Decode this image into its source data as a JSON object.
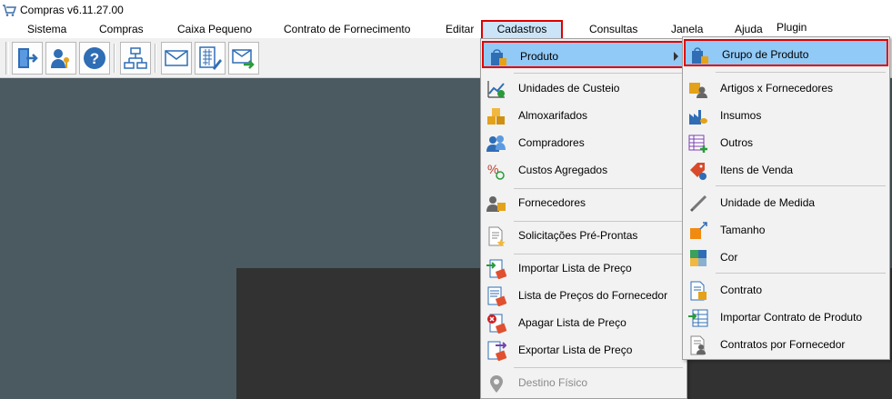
{
  "window": {
    "title": "Compras v6.11.27.00",
    "app_icon": "cart-icon"
  },
  "menubar": {
    "items": [
      "Sistema",
      "Compras",
      "Caixa Pequeno",
      "Contrato de Fornecimento",
      "Editar",
      "Cadastros",
      "Consultas",
      "Janela",
      "Ajuda",
      "Plugin"
    ],
    "active": "Cadastros"
  },
  "toolbar": {
    "buttons": [
      "exit-door-icon",
      "user-key-icon",
      "help-icon",
      "org-chart-icon",
      "envelope-icon",
      "calculator-pen-icon",
      "send-mail-icon"
    ]
  },
  "cadastros_menu": {
    "items": [
      {
        "label": "Produto",
        "icon": "product-bag-icon",
        "submenu": true,
        "selected": true
      },
      {
        "label": "Unidades de Custeio",
        "icon": "chart-money-icon"
      },
      {
        "label": "Almoxarifados",
        "icon": "boxes-icon"
      },
      {
        "label": "Compradores",
        "icon": "people-icon"
      },
      {
        "label": "Custos Agregados",
        "icon": "percent-icon"
      },
      {
        "label": "Fornecedores",
        "icon": "supplier-icon"
      },
      {
        "label": "Solicitações Pré-Prontas",
        "icon": "document-star-icon"
      },
      {
        "label": "Importar Lista de Preço",
        "icon": "import-price-icon"
      },
      {
        "label": "Lista de Preços do Fornecedor",
        "icon": "price-list-icon"
      },
      {
        "label": "Apagar Lista de Preço",
        "icon": "delete-price-icon"
      },
      {
        "label": "Exportar Lista de Preço",
        "icon": "export-price-icon"
      },
      {
        "label": "Destino Físico",
        "icon": "location-pin-icon",
        "disabled": true
      }
    ]
  },
  "produto_submenu": {
    "items": [
      {
        "label": "Grupo de Produto",
        "icon": "product-group-icon",
        "selected": true
      },
      {
        "label": "Artigos x Fornecedores",
        "icon": "article-supplier-icon"
      },
      {
        "label": "Insumos",
        "icon": "factory-icon"
      },
      {
        "label": "Outros",
        "icon": "table-plus-icon"
      },
      {
        "label": "Itens de Venda",
        "icon": "price-tag-icon"
      },
      {
        "label": "Unidade de Medida",
        "icon": "ruler-pencil-icon"
      },
      {
        "label": "Tamanho",
        "icon": "resize-icon"
      },
      {
        "label": "Cor",
        "icon": "color-swatch-icon"
      },
      {
        "label": "Contrato",
        "icon": "contract-icon"
      },
      {
        "label": "Importar Contrato de Produto",
        "icon": "import-contract-icon"
      },
      {
        "label": "Contratos por Fornecedor",
        "icon": "supplier-contract-icon"
      }
    ]
  },
  "colors": {
    "highlight_bg": "#91c9f7",
    "highlight_border": "#e00000",
    "workspace": "#4a5a60",
    "menu_bg": "#f2f2f2"
  }
}
